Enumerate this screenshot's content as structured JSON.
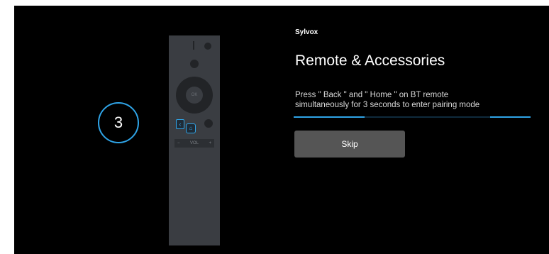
{
  "step": {
    "number": "3"
  },
  "remote": {
    "ok_label": "OK",
    "back_icon": "chevron-left-icon",
    "home_icon": "home-icon",
    "volume_minus": "−",
    "volume_label": "VOL",
    "volume_plus": "+"
  },
  "header": {
    "brand": "Sylvox",
    "title": "Remote & Accessories"
  },
  "instruction": {
    "line1": "Press \" Back \" and \" Home \" on BT remote",
    "line2": "simultaneously for 3 seconds to enter pairing mode"
  },
  "progress": {
    "value": 0.3
  },
  "actions": {
    "skip_label": "Skip"
  },
  "colors": {
    "accent": "#2fa4e7",
    "background": "#000000",
    "button": "#555555"
  }
}
